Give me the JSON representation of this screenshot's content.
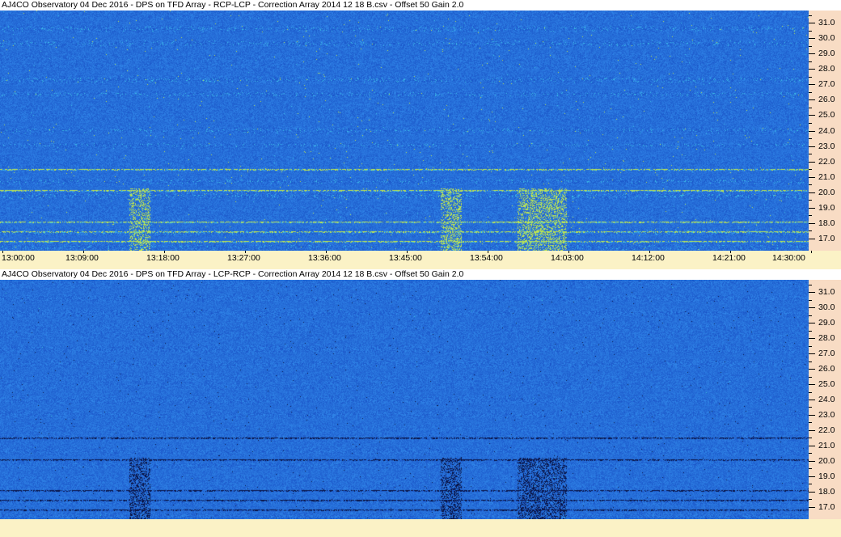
{
  "chart_data": [
    {
      "type": "heatmap",
      "title": "AJ4CO Observatory 04 Dec 2016  -  DPS on TFD Array  -  RCP-LCP  -  Correction Array 2014 12 18 B.csv  -  Offset 50  Gain 2.0",
      "polarity": "RCP-LCP",
      "y_ticks": [
        "31.0",
        "30.0",
        "29.0",
        "28.0",
        "27.0",
        "26.0",
        "25.0",
        "24.0",
        "23.0",
        "22.0",
        "21.0",
        "20.0",
        "19.0",
        "18.0",
        "17.0"
      ],
      "x_ticks": [
        "13:00:00",
        "13:09:00",
        "13:18:00",
        "13:27:00",
        "13:36:00",
        "13:45:00",
        "13:54:00",
        "14:03:00",
        "14:12:00",
        "14:21:00",
        "14:30:00"
      ],
      "ylim": [
        16.2,
        31.8
      ],
      "xlim": [
        "13:00:00",
        "14:30:00"
      ],
      "background_color": "#2060e8",
      "highlight_color": "#c8f040"
    },
    {
      "type": "heatmap",
      "title": "AJ4CO Observatory 04 Dec 2016  -  DPS on TFD Array  -  LCP-RCP  -  Correction Array 2014 12 18 B.csv  -  Offset 50  Gain 2.0",
      "polarity": "LCP-RCP",
      "y_ticks": [
        "31.0",
        "30.0",
        "29.0",
        "28.0",
        "27.0",
        "26.0",
        "25.0",
        "24.0",
        "23.0",
        "22.0",
        "21.0",
        "20.0",
        "19.0",
        "18.0",
        "17.0"
      ],
      "x_ticks": [],
      "ylim": [
        16.2,
        31.8
      ],
      "xlim": [
        "13:00:00",
        "14:30:00"
      ],
      "background_color": "#2060e8",
      "highlight_color": "#0a1a50"
    }
  ]
}
